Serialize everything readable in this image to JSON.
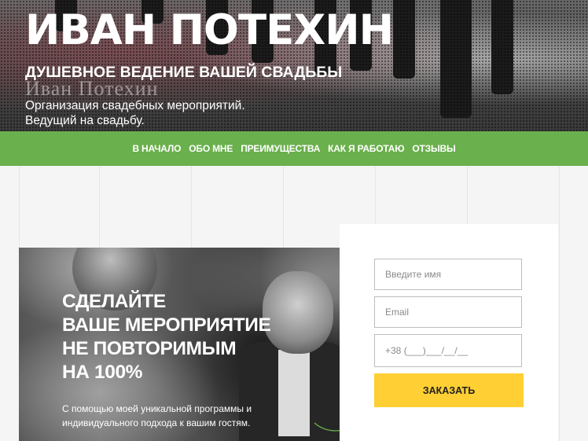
{
  "hero": {
    "name": "ИВАН ПОТЕХИН",
    "subtitle": "ДУШЕВНОЕ ВЕДЕНИЕ ВАШЕЙ СВАДЬБЫ",
    "ghost_text": "Иван Потехин",
    "description_line1": "Организация свадебных мероприятий.",
    "description_line2": "Ведущий на свадьбу."
  },
  "nav": {
    "items": [
      {
        "label": "В НАЧАЛО"
      },
      {
        "label": "ОБО МНЕ"
      },
      {
        "label": "ПРЕИМУЩЕСТВА"
      },
      {
        "label": "КАК Я РАБОТАЮ"
      },
      {
        "label": "ОТЗЫВЫ"
      }
    ],
    "background": "#6ab04c"
  },
  "promo": {
    "title_lines": [
      "СДЕЛАЙТЕ",
      "ВАШЕ МЕРОПРИЯТИЕ",
      "НЕ ПОВТОРИМЫМ",
      "НА 100%"
    ],
    "text": "С помощью моей уникальной программы и индивидуального подхода к вашим гостям."
  },
  "form": {
    "name_placeholder": "Введите имя",
    "email_placeholder": "Email",
    "phone_placeholder": "+38 (___)___/__/__",
    "submit_label": "ЗАКАЗАТЬ",
    "submit_color": "#ffcf33"
  }
}
